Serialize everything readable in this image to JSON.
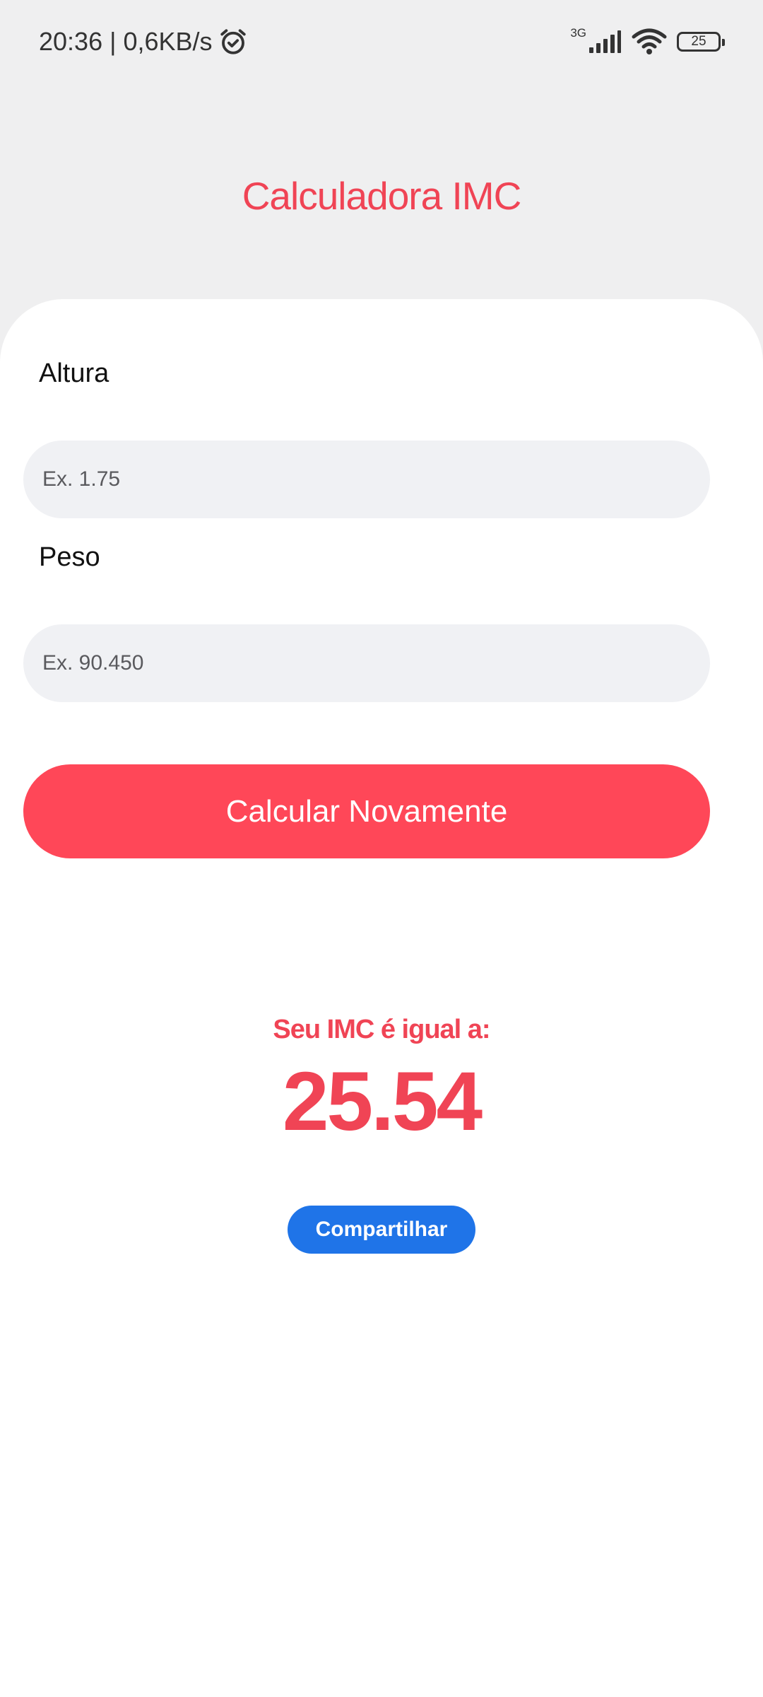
{
  "status_bar": {
    "time_speed": "20:36 | 0,6KB/s",
    "network_type": "3G",
    "battery_level": "25",
    "icons": [
      "alarm-icon",
      "signal-icon",
      "wifi-icon",
      "battery-icon"
    ]
  },
  "app": {
    "title": "Calculadora IMC"
  },
  "form": {
    "height_label": "Altura",
    "height_placeholder": "Ex. 1.75",
    "weight_label": "Peso",
    "weight_placeholder": "Ex. 90.450",
    "calc_button_label": "Calcular Novamente"
  },
  "result": {
    "label": "Seu IMC é igual a:",
    "value": "25.54",
    "share_button_label": "Compartilhar"
  },
  "colors": {
    "accent": "#f04455",
    "button_red": "#ff4758",
    "share_blue": "#1f74e8",
    "background": "#efeff0",
    "card": "#ffffff",
    "input_bg": "#f0f1f4"
  }
}
